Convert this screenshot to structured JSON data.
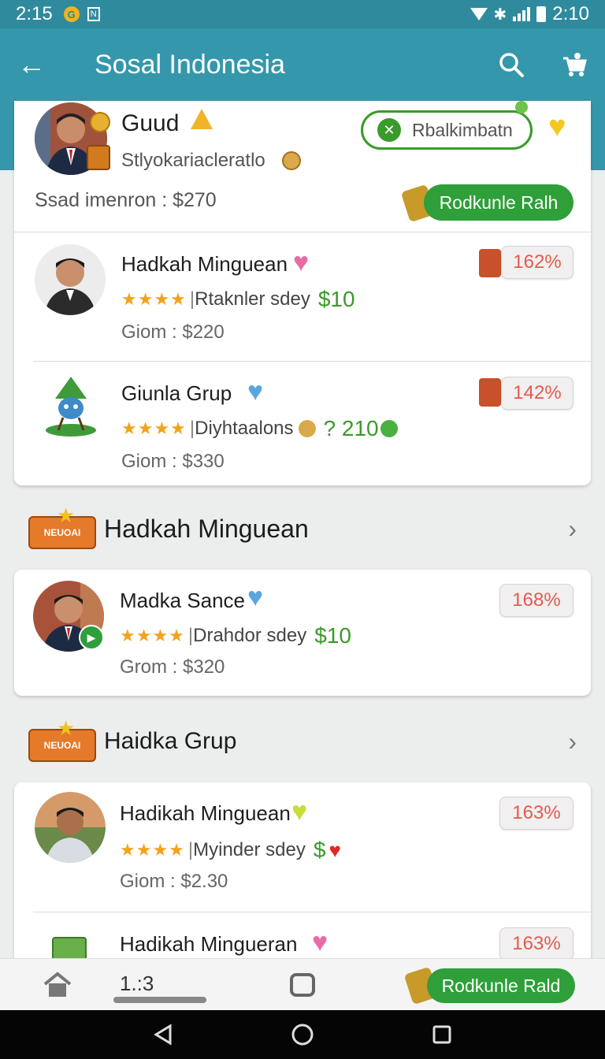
{
  "status_bar": {
    "time_left": "2:15",
    "time_right": "2:10",
    "badge": "G",
    "n_icon": "N"
  },
  "app_bar": {
    "title": "Sosal Indonesia"
  },
  "top_card": {
    "name": "Guud",
    "subtitle": "Stlyokariacleratlo",
    "summary": "Ssad imenron : $270",
    "outline_button": "Rbalkimbatn",
    "green_button": "Rodkunle Ralh"
  },
  "items_top": [
    {
      "name": "Hadkah Minguean",
      "desc": "Rtaknler sdey",
      "price": "$10",
      "meta": "Giom : $220",
      "percent": "162%"
    },
    {
      "name": "Giunla Grup",
      "desc": "Diyhtaalons",
      "price": "? 210",
      "meta": "Giom : $330",
      "percent": "142%"
    }
  ],
  "section_1": {
    "title": "Hadkah Minguean",
    "badge": "NEUOAI"
  },
  "items_mid": [
    {
      "name": "Madka Sance",
      "desc": "Drahdor sdey",
      "price": "$10",
      "meta": "Grom : $320",
      "percent": "168%"
    }
  ],
  "section_2": {
    "title": "Haidka Grup",
    "badge": "NEUOAI"
  },
  "items_bottom": [
    {
      "name": "Hadikah Minguean",
      "desc": "Myinder sdey",
      "price": "$",
      "meta": "Giom : $2.30",
      "percent": "163%"
    },
    {
      "name": "Hadikah Mingueran",
      "percent": "163%"
    }
  ],
  "stars": "★★★★",
  "bottom_bar": {
    "page_indicator": "1.:3",
    "green_button": "Rodkunle Rald"
  },
  "colors": {
    "teal": "#3497ac",
    "green": "#2e9f39",
    "percent_text": "#e25b4e",
    "star": "#f2a31b"
  }
}
